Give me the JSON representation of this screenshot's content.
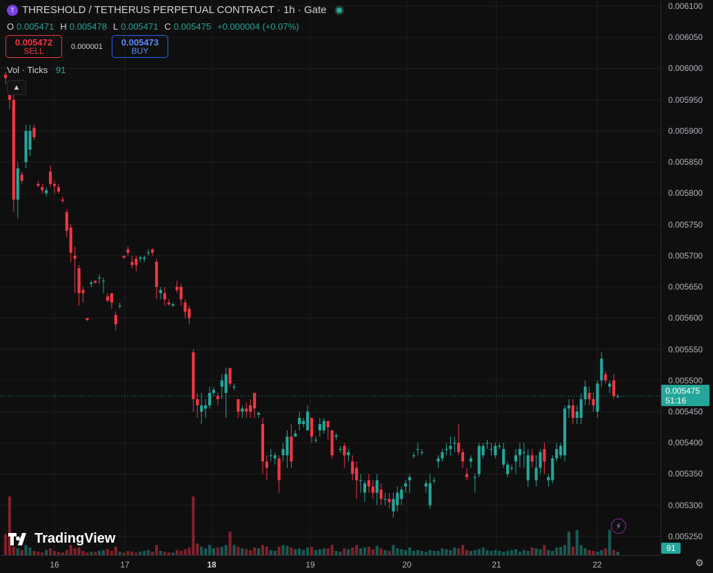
{
  "header": {
    "title": "THRESHOLD / TETHERUS PERPETUAL CONTRACT · 1h · Gate",
    "symbol_icon": "threshold-logo-icon",
    "status_icon": "market-open-dot-icon"
  },
  "ohlc": {
    "o_label": "O",
    "o_value": "0.005471",
    "h_label": "H",
    "h_value": "0.005478",
    "l_label": "L",
    "l_value": "0.005471",
    "c_label": "C",
    "c_value": "0.005475",
    "change": "+0.000004 (+0.07%)"
  },
  "trade": {
    "sell_price": "0.005472",
    "sell_label": "SELL",
    "spread": "0.000001",
    "buy_price": "0.005473",
    "buy_label": "BUY"
  },
  "volume_legend": {
    "label": "Vol · Ticks",
    "value": "91"
  },
  "price_tag": {
    "price": "0.005475",
    "countdown": "51:16"
  },
  "volume_tag": "91",
  "watermark": "TradingView",
  "colors": {
    "up": "#26a69a",
    "down": "#f23645",
    "background": "#0f0f0f",
    "grid": "#1f1f1f"
  },
  "chart_data": {
    "type": "candlestick",
    "title": "THRESHOLD / TETHERUS PERPETUAL CONTRACT · 1h · Gate",
    "x_tick_labels": [
      "16",
      "17",
      "18",
      "19",
      "20",
      "21",
      "22"
    ],
    "y_tick_labels": [
      "0.006100",
      "0.006050",
      "0.006000",
      "0.005950",
      "0.005900",
      "0.005850",
      "0.005800",
      "0.005750",
      "0.005700",
      "0.005650",
      "0.005600",
      "0.005550",
      "0.005500",
      "0.005450",
      "0.005400",
      "0.005350",
      "0.005300",
      "0.005250"
    ],
    "ylim": [
      0.00522,
      0.00611
    ],
    "last_price": 0.005475,
    "grid": true,
    "candles": [
      [
        0.00599,
        0.005995,
        0.005975,
        0.005985
      ],
      [
        0.00596,
        0.005975,
        0.005935,
        0.00595
      ],
      [
        0.00595,
        0.00596,
        0.00577,
        0.00579
      ],
      [
        0.00579,
        0.00585,
        0.00576,
        0.00584
      ],
      [
        0.00583,
        0.005835,
        0.005815,
        0.00582
      ],
      [
        0.00585,
        0.00591,
        0.00584,
        0.0059
      ],
      [
        0.00587,
        0.00591,
        0.00586,
        0.0059
      ],
      [
        0.005905,
        0.00591,
        0.005885,
        0.00589
      ],
      [
        0.005815,
        0.00582,
        0.00581,
        0.005812
      ],
      [
        0.00581,
        0.005815,
        0.0058,
        0.005805
      ],
      [
        0.0058,
        0.00581,
        0.005795,
        0.005805
      ],
      [
        0.005835,
        0.005845,
        0.00581,
        0.005815
      ],
      [
        0.005815,
        0.00582,
        0.0058,
        0.005812
      ],
      [
        0.00581,
        0.005815,
        0.0058,
        0.005803
      ],
      [
        0.00579,
        0.005795,
        0.005785,
        0.005788
      ],
      [
        0.00577,
        0.005775,
        0.00573,
        0.00574
      ],
      [
        0.005745,
        0.00575,
        0.00569,
        0.005705
      ],
      [
        0.0057,
        0.005715,
        0.00564,
        0.005695
      ],
      [
        0.00568,
        0.005685,
        0.00562,
        0.00564
      ],
      [
        0.005645,
        0.00565,
        0.005625,
        0.00564
      ],
      [
        0.0056,
        0.0056,
        0.005595,
        0.005597
      ],
      [
        0.005655,
        0.00566,
        0.00565,
        0.005657
      ],
      [
        0.00566,
        0.00566,
        0.005655,
        0.005657
      ],
      [
        0.005665,
        0.00567,
        0.005655,
        0.005665
      ],
      [
        0.00566,
        0.005665,
        0.00564,
        0.00566
      ],
      [
        0.005635,
        0.00564,
        0.005625,
        0.005628
      ],
      [
        0.00564,
        0.00564,
        0.005615,
        0.005625
      ],
      [
        0.005605,
        0.00561,
        0.00558,
        0.00559
      ],
      [
        0.00562,
        0.005625,
        0.005615,
        0.00562
      ],
      [
        0.0057,
        0.0057,
        0.005695,
        0.005697
      ],
      [
        0.00571,
        0.005715,
        0.0057,
        0.005705
      ],
      [
        0.00569,
        0.0057,
        0.00568,
        0.005685
      ],
      [
        0.005695,
        0.0057,
        0.005675,
        0.005685
      ],
      [
        0.005695,
        0.0057,
        0.00569,
        0.005697
      ],
      [
        0.005695,
        0.0057,
        0.00569,
        0.005697
      ],
      [
        0.005705,
        0.00571,
        0.0057,
        0.005705
      ],
      [
        0.00571,
        0.005712,
        0.0057,
        0.005705
      ],
      [
        0.00569,
        0.005695,
        0.00563,
        0.00565
      ],
      [
        0.00564,
        0.00565,
        0.00563,
        0.005645
      ],
      [
        0.00564,
        0.00565,
        0.00562,
        0.00563
      ],
      [
        0.005625,
        0.00563,
        0.00562,
        0.005622
      ],
      [
        0.00562,
        0.005625,
        0.005618,
        0.005622
      ],
      [
        0.00565,
        0.00566,
        0.00564,
        0.005645
      ],
      [
        0.00565,
        0.005655,
        0.00562,
        0.00563
      ],
      [
        0.005625,
        0.00563,
        0.0056,
        0.00561
      ],
      [
        0.005615,
        0.00562,
        0.00559,
        0.0056
      ],
      [
        0.005545,
        0.00555,
        0.00545,
        0.00547
      ],
      [
        0.00547,
        0.00548,
        0.00544,
        0.00546
      ],
      [
        0.00545,
        0.00548,
        0.00543,
        0.00546
      ],
      [
        0.005455,
        0.00547,
        0.00544,
        0.00546
      ],
      [
        0.00546,
        0.00549,
        0.005455,
        0.00548
      ],
      [
        0.00548,
        0.00549,
        0.005475,
        0.005485
      ],
      [
        0.005475,
        0.00548,
        0.00546,
        0.00547
      ],
      [
        0.00549,
        0.00551,
        0.00547,
        0.0055
      ],
      [
        0.00548,
        0.00552,
        0.00544,
        0.00551
      ],
      [
        0.00552,
        0.00552,
        0.00549,
        0.005495
      ],
      [
        0.00549,
        0.005495,
        0.005485,
        0.00549
      ],
      [
        0.00547,
        0.00547,
        0.00544,
        0.00545
      ],
      [
        0.00545,
        0.00546,
        0.00544,
        0.005455
      ],
      [
        0.005455,
        0.005465,
        0.00544,
        0.00545
      ],
      [
        0.00546,
        0.00547,
        0.00544,
        0.00545
      ],
      [
        0.00548,
        0.00548,
        0.00544,
        0.005455
      ],
      [
        0.005445,
        0.00545,
        0.00544,
        0.005448
      ],
      [
        0.00543,
        0.00544,
        0.00535,
        0.00537
      ],
      [
        0.00537,
        0.00538,
        0.00534,
        0.00536
      ],
      [
        0.00538,
        0.00539,
        0.00537,
        0.00538
      ],
      [
        0.005375,
        0.005385,
        0.005365,
        0.00538
      ],
      [
        0.005375,
        0.00538,
        0.00532,
        0.00534
      ],
      [
        0.00538,
        0.0054,
        0.00537,
        0.00539
      ],
      [
        0.00538,
        0.00542,
        0.00536,
        0.00541
      ],
      [
        0.00541,
        0.00543,
        0.00536,
        0.00537
      ],
      [
        0.00541,
        0.00542,
        0.00541,
        0.005415
      ],
      [
        0.00543,
        0.00545,
        0.00542,
        0.00544
      ],
      [
        0.00543,
        0.00544,
        0.005425,
        0.005435
      ],
      [
        0.00542,
        0.00546,
        0.00542,
        0.00545
      ],
      [
        0.00544,
        0.00544,
        0.0054,
        0.00541
      ],
      [
        0.005405,
        0.00541,
        0.0054,
        0.005405
      ],
      [
        0.00542,
        0.00544,
        0.00541,
        0.00543
      ],
      [
        0.00542,
        0.00544,
        0.005415,
        0.005435
      ],
      [
        0.005435,
        0.005435,
        0.005405,
        0.005425
      ],
      [
        0.00542,
        0.00542,
        0.005375,
        0.00538
      ],
      [
        0.00541,
        0.005415,
        0.005405,
        0.005412
      ],
      [
        0.00539,
        0.005395,
        0.005385,
        0.00539
      ],
      [
        0.005395,
        0.0054,
        0.00536,
        0.00538
      ],
      [
        0.00538,
        0.00539,
        0.00537,
        0.005385
      ],
      [
        0.00537,
        0.00538,
        0.00534,
        0.00535
      ],
      [
        0.00536,
        0.00537,
        0.00531,
        0.00534
      ],
      [
        0.00534,
        0.00535,
        0.00532,
        0.00534
      ],
      [
        0.00532,
        0.00534,
        0.005305,
        0.005335
      ],
      [
        0.00534,
        0.00535,
        0.00532,
        0.00533
      ],
      [
        0.00533,
        0.00534,
        0.00531,
        0.00532
      ],
      [
        0.00532,
        0.00535,
        0.0053,
        0.00534
      ],
      [
        0.005325,
        0.005335,
        0.0053,
        0.00531
      ],
      [
        0.00531,
        0.00532,
        0.0053,
        0.00531
      ],
      [
        0.00531,
        0.00532,
        0.005295,
        0.005305
      ],
      [
        0.00529,
        0.00532,
        0.00528,
        0.00531
      ],
      [
        0.0053,
        0.00533,
        0.00529,
        0.00532
      ],
      [
        0.00531,
        0.00533,
        0.0053,
        0.005325
      ],
      [
        0.00533,
        0.00534,
        0.00532,
        0.005335
      ],
      [
        0.00534,
        0.00535,
        0.00532,
        0.005345
      ],
      [
        0.00538,
        0.005385,
        0.005375,
        0.00538
      ],
      [
        0.00539,
        0.0054,
        0.00538,
        0.00539
      ],
      [
        0.005385,
        0.00539,
        0.00538,
        0.005385
      ],
      [
        0.00533,
        0.00534,
        0.00532,
        0.005335
      ],
      [
        0.0053,
        0.00535,
        0.005295,
        0.005335
      ],
      [
        0.00534,
        0.005345,
        0.005335,
        0.00534
      ],
      [
        0.00537,
        0.00538,
        0.00536,
        0.005375
      ],
      [
        0.005375,
        0.00539,
        0.00537,
        0.005385
      ],
      [
        0.00539,
        0.0054,
        0.00538,
        0.00539
      ],
      [
        0.00539,
        0.00541,
        0.00538,
        0.005395
      ],
      [
        0.0054,
        0.00541,
        0.005385,
        0.0054
      ],
      [
        0.0054,
        0.00543,
        0.00538,
        0.005385
      ],
      [
        0.005385,
        0.00539,
        0.00536,
        0.00537
      ],
      [
        0.00535,
        0.00536,
        0.00534,
        0.005345
      ],
      [
        0.00537,
        0.00538,
        0.00536,
        0.005375
      ],
      [
        0.005345,
        0.00535,
        0.00532,
        0.005345
      ],
      [
        0.00535,
        0.0054,
        0.005345,
        0.005395
      ],
      [
        0.00538,
        0.0054,
        0.005375,
        0.005395
      ],
      [
        0.0054,
        0.005405,
        0.00539,
        0.0054
      ],
      [
        0.00539,
        0.0054,
        0.00538,
        0.00539
      ],
      [
        0.00538,
        0.0054,
        0.005375,
        0.005395
      ],
      [
        0.005395,
        0.0054,
        0.00539,
        0.005395
      ],
      [
        0.005365,
        0.0054,
        0.00536,
        0.00539
      ],
      [
        0.00535,
        0.00537,
        0.005345,
        0.005365
      ],
      [
        0.00536,
        0.005365,
        0.005355,
        0.00536
      ],
      [
        0.00537,
        0.00539,
        0.00535,
        0.00538
      ],
      [
        0.00538,
        0.0054,
        0.00536,
        0.00539
      ],
      [
        0.005385,
        0.0054,
        0.00536,
        0.005385
      ],
      [
        0.00534,
        0.00539,
        0.00533,
        0.00538
      ],
      [
        0.00538,
        0.00539,
        0.00536,
        0.00537
      ],
      [
        0.00534,
        0.00538,
        0.00533,
        0.00536
      ],
      [
        0.00536,
        0.00539,
        0.00535,
        0.005385
      ],
      [
        0.00539,
        0.0054,
        0.00535,
        0.00537
      ],
      [
        0.00534,
        0.00535,
        0.00533,
        0.005345
      ],
      [
        0.00534,
        0.00538,
        0.005335,
        0.005375
      ],
      [
        0.005375,
        0.0054,
        0.00537,
        0.00539
      ],
      [
        0.00538,
        0.0054,
        0.005375,
        0.005395
      ],
      [
        0.00538,
        0.00546,
        0.00537,
        0.005455
      ],
      [
        0.005455,
        0.00547,
        0.00544,
        0.00546
      ],
      [
        0.00546,
        0.00547,
        0.00543,
        0.00544
      ],
      [
        0.00544,
        0.00546,
        0.00543,
        0.00545
      ],
      [
        0.00544,
        0.00548,
        0.00543,
        0.00547
      ],
      [
        0.00547,
        0.0055,
        0.00546,
        0.00549
      ],
      [
        0.00548,
        0.00549,
        0.00546,
        0.00547
      ],
      [
        0.00547,
        0.00548,
        0.00545,
        0.00546
      ],
      [
        0.00545,
        0.0055,
        0.00544,
        0.005495
      ],
      [
        0.0055,
        0.005545,
        0.00549,
        0.005535
      ],
      [
        0.00551,
        0.005515,
        0.005495,
        0.0055
      ],
      [
        0.00549,
        0.0055,
        0.00548,
        0.005495
      ],
      [
        0.0055,
        0.00551,
        0.00547,
        0.005475
      ],
      [
        0.005475,
        0.005478,
        0.005471,
        0.005475
      ]
    ],
    "volumes": [
      25,
      70,
      10,
      8,
      6,
      12,
      9,
      5,
      4,
      3,
      6,
      8,
      5,
      4,
      3,
      6,
      12,
      8,
      9,
      5,
      3,
      4,
      4,
      5,
      6,
      7,
      5,
      10,
      4,
      3,
      5,
      4,
      3,
      4,
      5,
      6,
      4,
      12,
      5,
      4,
      3,
      3,
      6,
      5,
      7,
      9,
      70,
      14,
      10,
      8,
      12,
      8,
      9,
      10,
      12,
      28,
      12,
      10,
      8,
      7,
      6,
      9,
      8,
      12,
      10,
      6,
      5,
      10,
      12,
      11,
      9,
      7,
      8,
      6,
      9,
      10,
      6,
      7,
      8,
      8,
      12,
      5,
      4,
      8,
      7,
      9,
      12,
      8,
      9,
      10,
      7,
      11,
      8,
      6,
      5,
      12,
      8,
      7,
      6,
      9,
      5,
      6,
      5,
      4,
      6,
      5,
      5,
      8,
      7,
      6,
      9,
      8,
      12,
      6,
      5,
      6,
      7,
      9,
      6,
      5,
      6,
      5,
      4,
      5,
      6,
      7,
      4,
      6,
      5,
      9,
      8,
      7,
      12,
      6,
      5,
      9,
      10,
      12,
      28,
      10,
      30,
      12,
      8,
      6,
      5,
      4,
      6,
      8,
      30,
      6,
      4,
      3
    ]
  }
}
